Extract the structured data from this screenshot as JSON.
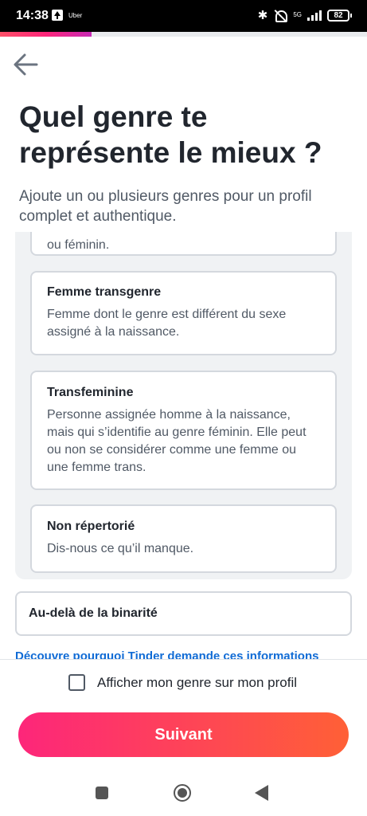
{
  "status_bar": {
    "time": "14:38",
    "app_label": "Uber",
    "network": "5G",
    "battery": "82"
  },
  "progress": {
    "value": 0.25
  },
  "header": {
    "title": "Quel genre te représente le mieux ?",
    "subtitle": "Ajoute un ou plusieurs genres pour un profil complet et authentique."
  },
  "options": {
    "partial_text": "ou féminin.",
    "items": [
      {
        "title": "Femme transgenre",
        "description": "Femme dont le genre est différent du sexe assigné à la naissance."
      },
      {
        "title": "Transfeminine",
        "description": "Personne assignée homme à la naissance, mais qui s’identifie au genre féminin. Elle peut ou non se considérer comme une femme ou une femme trans."
      },
      {
        "title": "Non répertorié",
        "description": "Dis-nous ce qu’il manque."
      }
    ]
  },
  "binary_button": "Au-delà de la binarité",
  "info_link": "Découvre pourquoi Tinder demande ces informations",
  "checkbox": {
    "label": "Afficher mon genre sur mon profil",
    "checked": false
  },
  "next_button": "Suivant",
  "icons": {
    "back": "arrow-left-icon",
    "recents": "square-icon",
    "home": "circle-icon",
    "nav_back": "triangle-back-icon"
  }
}
